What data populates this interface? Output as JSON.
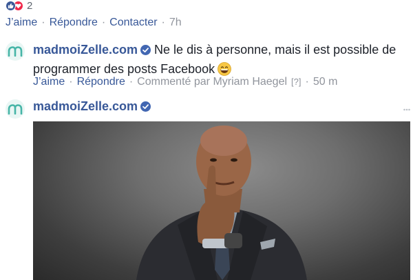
{
  "reactions": {
    "count": "2",
    "icons": [
      "like-icon",
      "love-icon"
    ]
  },
  "post_actions": {
    "like": "J’aime",
    "reply": "Répondre",
    "contact": "Contacter",
    "time": "7h"
  },
  "comment1": {
    "author": "madmoiZelle.com",
    "text": "Ne le dis à personne, mais il est possible de programmer des posts Facebook",
    "emoji": "grinning-face-emoji",
    "actions": {
      "like": "J’aime",
      "reply": "Répondre",
      "commented_by": "Commenté par Myriam Haegel",
      "help": "[?]",
      "time": "50 m"
    }
  },
  "comment2": {
    "author": "madmoiZelle.com",
    "media": "shush-gesture-image"
  },
  "colors": {
    "link": "#385898",
    "muted": "#90949c",
    "verified": "#4267b2",
    "avatar_m": "#46b5a7"
  }
}
